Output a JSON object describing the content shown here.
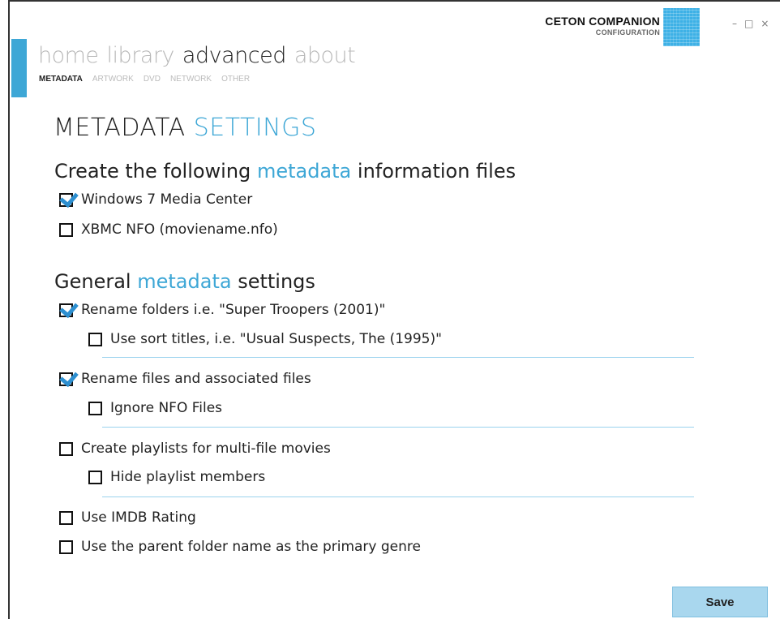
{
  "brand": {
    "name": "CETON COMPANION",
    "subtitle": "CONFIGURATION"
  },
  "window_controls": {
    "minimize": "–",
    "maximize": "□",
    "close": "×"
  },
  "nav": {
    "main": [
      "home",
      "library",
      "advanced",
      "about"
    ],
    "sub": [
      "METADATA",
      "ARTWORK",
      "DVD",
      "NETWORK",
      "OTHER"
    ]
  },
  "page": {
    "title_main": "METADATA",
    "title_accent": "SETTINGS"
  },
  "sections": {
    "create": {
      "pre": "Create the following",
      "accent": "metadata",
      "post": "information files"
    },
    "general": {
      "pre": "General",
      "accent": "metadata",
      "post": "settings"
    }
  },
  "options": {
    "win7": "Windows 7 Media Center",
    "xbmc": "XBMC NFO (moviename.nfo)",
    "rename_folders": "Rename folders i.e. \"Super Troopers (2001)\"",
    "sort_titles": "Use sort titles, i.e. \"Usual Suspects, The (1995)\"",
    "rename_files": "Rename files and associated files",
    "ignore_nfo": "Ignore NFO Files",
    "playlists": "Create playlists for multi-file movies",
    "hide_members": "Hide playlist members",
    "imdb": "Use IMDB Rating",
    "parent_genre": "Use the parent folder name as the primary genre"
  },
  "save_label": "Save",
  "colors": {
    "accent": "#3ea7d6",
    "check": "#2d8fd0",
    "button": "#a9d7ee"
  }
}
